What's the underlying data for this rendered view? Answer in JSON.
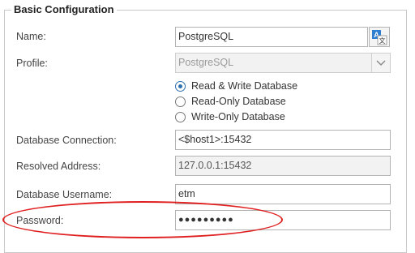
{
  "group": {
    "title": "Basic Configuration"
  },
  "name": {
    "label": "Name:",
    "value": "PostgreSQL",
    "icon": "translate-icon"
  },
  "profile": {
    "label": "Profile:",
    "value": "PostgreSQL",
    "icon": "chevron-down-icon"
  },
  "access_mode": {
    "options": [
      {
        "label": "Read & Write Database",
        "selected": true
      },
      {
        "label": "Read-Only Database",
        "selected": false
      },
      {
        "label": "Write-Only Database",
        "selected": false
      }
    ]
  },
  "database_connection": {
    "label": "Database Connection:",
    "value": "<$host1>:15432"
  },
  "resolved_address": {
    "label": "Resolved Address:",
    "value": "127.0.0.1:15432"
  },
  "database_username": {
    "label": "Database Username:",
    "value": "etm"
  },
  "password": {
    "label": "Password:",
    "value": "●●●●●●●●●"
  },
  "highlight": {
    "color": "#e02020"
  }
}
